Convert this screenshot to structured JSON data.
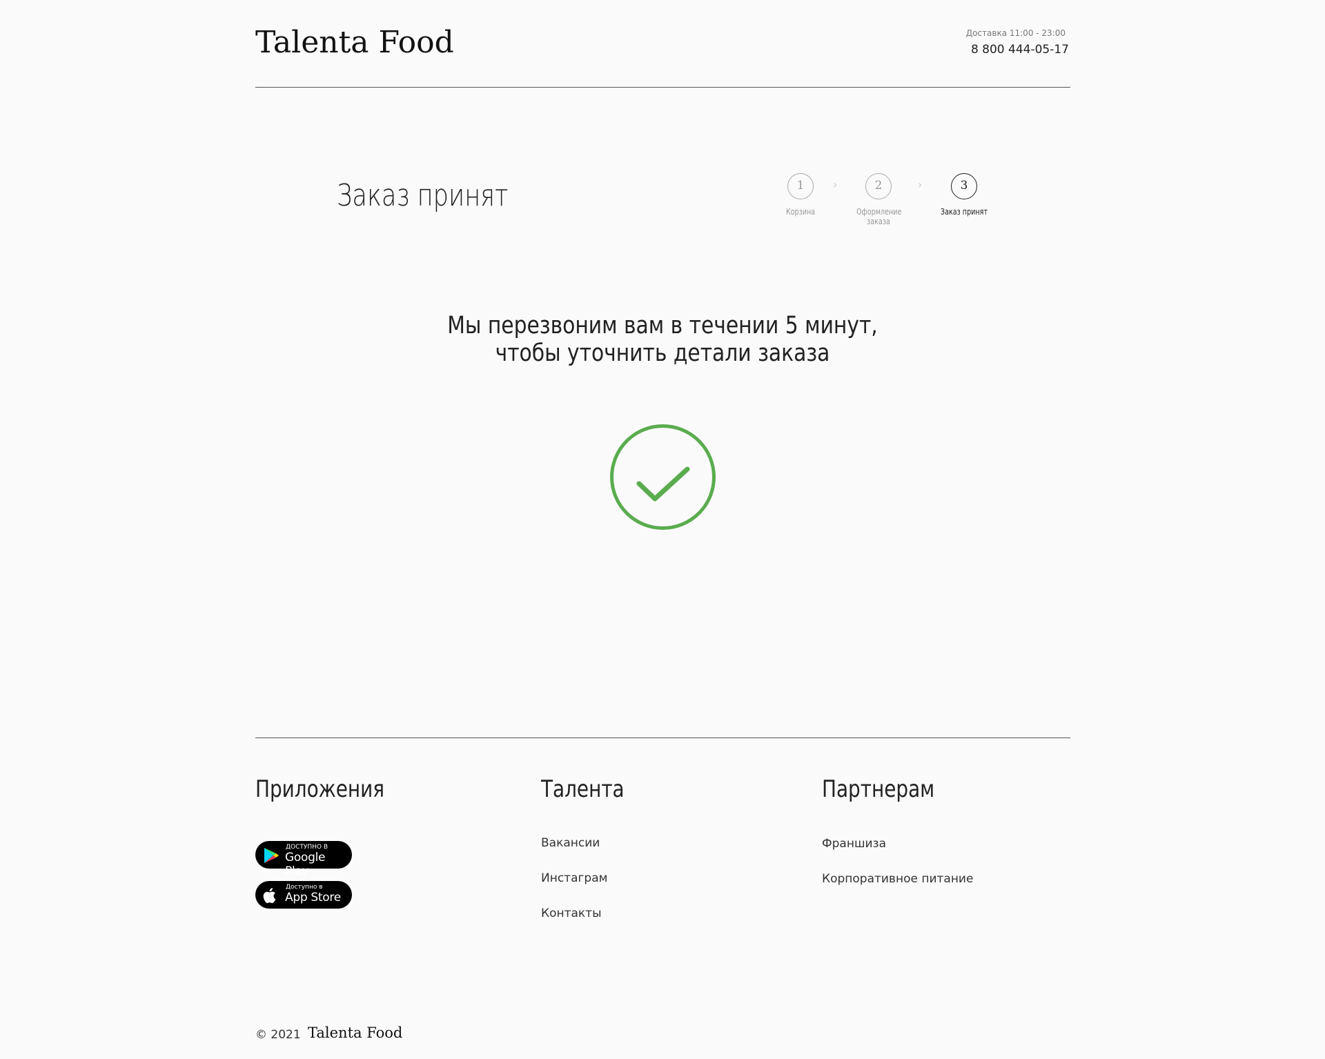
{
  "header": {
    "logo": "Talenta Food",
    "delivery": "Доставка 11:00 - 23:00",
    "phone": "8 800 444-05-17"
  },
  "main": {
    "title": "Заказ принят",
    "steps": [
      {
        "number": "1",
        "label": "Корзина"
      },
      {
        "number": "2",
        "label": "Оформление заказа"
      },
      {
        "number": "3",
        "label": "Заказ принят"
      }
    ],
    "message": "Мы перезвоним вам в течении 5 минут, чтобы уточнить детали заказа"
  },
  "colors": {
    "success": "#5aac4e",
    "background": "#fafafa"
  },
  "footer": {
    "apps_title": "Приложения",
    "google_play": {
      "small": "ДОСТУПНО В",
      "big": "Google Play"
    },
    "app_store": {
      "small": "Доступно в",
      "big": "App Store"
    },
    "talenta_title": "Талента",
    "talenta_links": [
      "Вакансии",
      "Инстаграм",
      "Контакты"
    ],
    "partners_title": "Партнерам",
    "partners_links": [
      "Франшиза",
      "Корпоративное питание"
    ],
    "copyright": "© 2021",
    "logo": "Talenta Food"
  }
}
